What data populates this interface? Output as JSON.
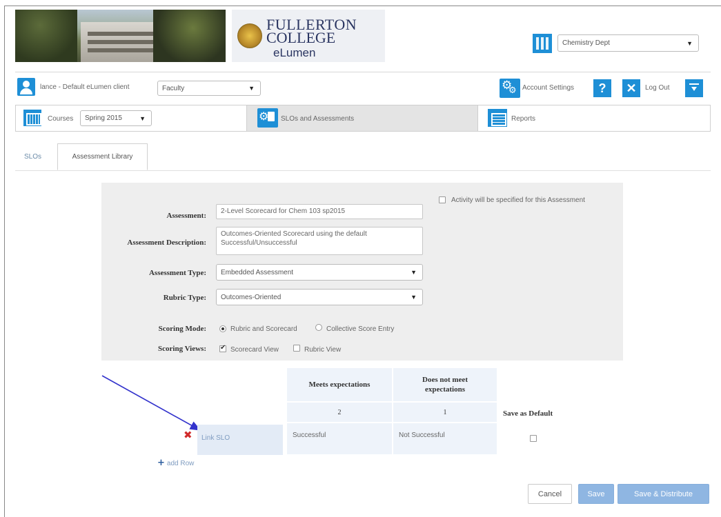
{
  "header": {
    "logo": {
      "line1": "FULLERTON",
      "line2": "COLLEGE",
      "line3": "eLumen"
    },
    "department_select": {
      "value": "Chemistry Dept",
      "icon": "org-chart-icon"
    }
  },
  "userbar": {
    "client_text": "lance - Default eLumen client",
    "role_select": {
      "value": "Faculty"
    },
    "account_settings_label": "Account Settings",
    "help_label": "?",
    "logout_x": "✕",
    "logout_label": "Log Out"
  },
  "nav": {
    "courses": {
      "label": "Courses",
      "term_select": "Spring 2015"
    },
    "slos_label": "SLOs and Assessments",
    "reports_label": "Reports"
  },
  "tabs": {
    "slos": "SLOs",
    "assessment_library": "Assessment Library"
  },
  "form": {
    "activity_checkbox_label": "Activity will be specified for this Assessment",
    "assessment_label": "Assessment:",
    "assessment_value": "2-Level Scorecard for Chem 103 sp2015",
    "description_label": "Assessment Description:",
    "description_value": "Outcomes-Oriented Scorecard using the default Successful/Unsuccessful",
    "type_label": "Assessment Type:",
    "type_value": "Embedded Assessment",
    "rubric_label": "Rubric Type:",
    "rubric_value": "Outcomes-Oriented",
    "scoring_mode_label": "Scoring Mode:",
    "scoring_mode_options": [
      "Rubric and Scorecard",
      "Collective Score Entry"
    ],
    "scoring_views_label": "Scoring Views:",
    "scoring_views_options": [
      "Scorecard View",
      "Rubric View"
    ]
  },
  "scorecard": {
    "columns": [
      {
        "header": "Meets expectations",
        "score": "2",
        "cell": "Successful"
      },
      {
        "header": "Does not meet expectations",
        "score": "1",
        "cell": "Not Successful"
      }
    ],
    "row_link_label": "Link SLO",
    "save_default_label": "Save as Default",
    "add_row_label": "add Row",
    "annotation_arrow_color": "#3333cc"
  },
  "actions": {
    "cancel": "Cancel",
    "save": "Save",
    "save_distribute": "Save & Distribute"
  },
  "colors": {
    "accent": "#1e8fd6",
    "delete": "#d12b2b",
    "button_blue": "#8fb6e2"
  }
}
